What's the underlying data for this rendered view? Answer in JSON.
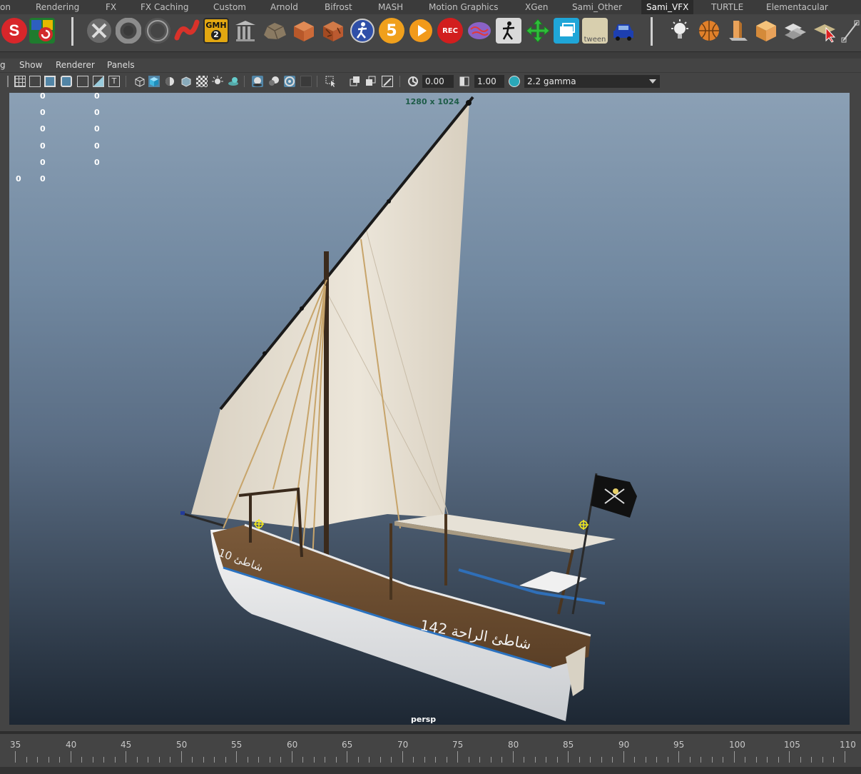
{
  "shelf_tabs": [
    {
      "label": "on"
    },
    {
      "label": "Rendering"
    },
    {
      "label": "FX"
    },
    {
      "label": "FX Caching"
    },
    {
      "label": "Custom"
    },
    {
      "label": "Arnold"
    },
    {
      "label": "Bifrost"
    },
    {
      "label": "MASH"
    },
    {
      "label": "Motion Graphics"
    },
    {
      "label": "XGen"
    },
    {
      "label": "Sami_Other"
    },
    {
      "label": "Sami_VFX"
    },
    {
      "label": "TURTLE"
    },
    {
      "label": "Elementacular"
    }
  ],
  "shelf_icons": {
    "gmh_top": "GMH",
    "gmh_num": "2",
    "five": "5",
    "rec": "REC",
    "tween": "tween"
  },
  "panel_menu": [
    {
      "label": "g"
    },
    {
      "label": "Show"
    },
    {
      "label": "Renderer"
    },
    {
      "label": "Panels"
    }
  ],
  "panel_toolbar": {
    "exposure": "0.00",
    "gamma": "1.00",
    "color_space": "2.2 gamma"
  },
  "viewport": {
    "resolution": "1280 x 1024",
    "camera": "persp",
    "hud_rows": [
      [
        "0",
        "0"
      ],
      [
        "0",
        "0"
      ],
      [
        "0",
        "0"
      ],
      [
        "0",
        "0"
      ],
      [
        "0",
        "0"
      ]
    ],
    "hud_last": [
      "0",
      "0"
    ],
    "boat_text": "142 شاطئ الراحة",
    "bow_text": "10 شاطئ"
  },
  "timeline": {
    "frames": [
      "35",
      "40",
      "45",
      "50",
      "55",
      "60",
      "65",
      "70",
      "75",
      "80",
      "85",
      "90",
      "95",
      "100",
      "105",
      "110"
    ]
  },
  "colors": {
    "active_tab": "#2b2b2b",
    "viewport_top": "#8ba0b5",
    "viewport_bottom": "#1d2733",
    "accent_teal": "#2aa8b8"
  }
}
